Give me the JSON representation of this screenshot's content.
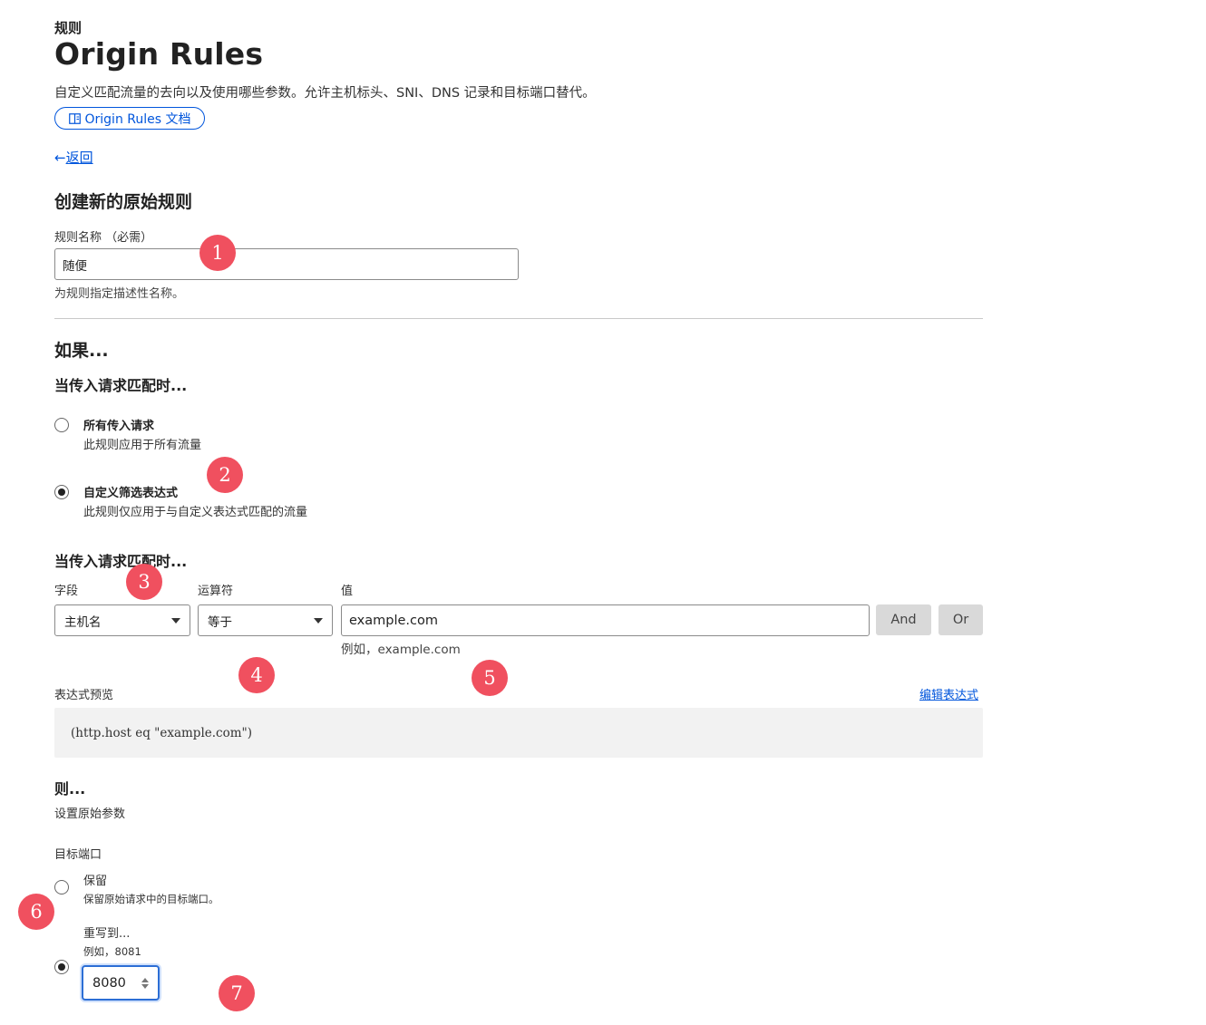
{
  "header": {
    "breadcrumb": "规则",
    "title": "Origin Rules",
    "description": "自定义匹配流量的去向以及使用哪些参数。允许主机标头、SNI、DNS 记录和目标端口替代。",
    "docs_button": "Origin Rules 文档",
    "docs_icon": "book-icon",
    "back_link": "返回",
    "back_icon": "arrow-left-icon"
  },
  "form": {
    "heading": "创建新的原始规则",
    "rule_name": {
      "label": "规则名称 （必需）",
      "value": "随便",
      "help": "为规则指定描述性名称。"
    }
  },
  "if_section": {
    "heading": "如果...",
    "match_heading": "当传入请求匹配时...",
    "options": [
      {
        "title": "所有传入请求",
        "subtitle": "此规则应用于所有流量",
        "selected": false
      },
      {
        "title": "自定义筛选表达式",
        "subtitle": "此规则仅应用于与自定义表达式匹配的流量",
        "selected": true
      }
    ],
    "match_heading_2": "当传入请求匹配时...",
    "field_label": "字段",
    "field_value": "主机名",
    "operator_label": "运算符",
    "operator_value": "等于",
    "value_label": "值",
    "value_value": "example.com",
    "value_help": "例如，example.com",
    "and_button": "And",
    "or_button": "Or"
  },
  "expression": {
    "label": "表达式预览",
    "edit_link": "编辑表达式",
    "preview": "(http.host eq \"example.com\")"
  },
  "then_section": {
    "heading": "则...",
    "subheading": "设置原始参数",
    "port_label": "目标端口",
    "options": [
      {
        "title": "保留",
        "subtitle": "保留原始请求中的目标端口。",
        "selected": false
      },
      {
        "title": "重写到...",
        "subtitle": "例如，8081",
        "selected": true
      }
    ],
    "port_value": "8080"
  },
  "markers": [
    "1",
    "2",
    "3",
    "4",
    "5",
    "6",
    "7"
  ],
  "colors": {
    "link": "#0055dc",
    "marker": "#f0505f",
    "focus": "#2c6ed5"
  }
}
